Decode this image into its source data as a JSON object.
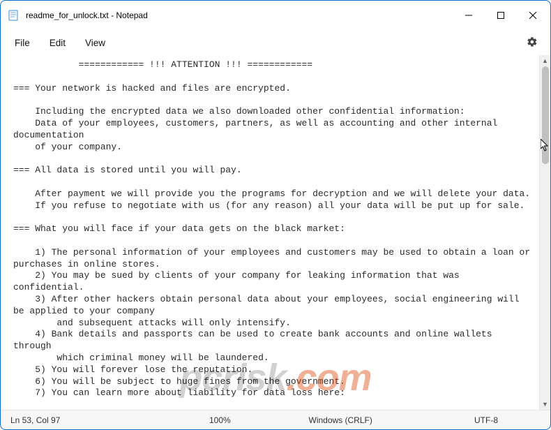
{
  "window": {
    "title": "readme_for_unlock.txt - Notepad"
  },
  "menu": {
    "file": "File",
    "edit": "Edit",
    "view": "View"
  },
  "document": {
    "text": "            ============ !!! ATTENTION !!! ============\n\n=== Your network is hacked and files are encrypted.\n\n    Including the encrypted data we also downloaded other confidential information:\n    Data of your employees, customers, partners, as well as accounting and other internal documentation\n    of your company.\n\n=== All data is stored until you will pay.\n\n    After payment we will provide you the programs for decryption and we will delete your data.\n    If you refuse to negotiate with us (for any reason) all your data will be put up for sale.\n\n=== What you will face if your data gets on the black market:\n\n    1) The personal information of your employees and customers may be used to obtain a loan or purchases in online stores.\n    2) You may be sued by clients of your company for leaking information that was confidential.\n    3) After other hackers obtain personal data about your employees, social engineering will be applied to your company\n        and subsequent attacks will only intensify.\n    4) Bank details and passports can be used to create bank accounts and online wallets through\n        which criminal money will be laundered.\n    5) You will forever lose the reputation.\n    6) You will be subject to huge fines from the government.\n    7) You can learn more about liability for data loss here:"
  },
  "status": {
    "position": "Ln 53, Col 97",
    "zoom": "100%",
    "line_ending": "Windows (CRLF)",
    "encoding": "UTF-8"
  },
  "watermark": {
    "text_a": "pcrisk",
    "text_b": ".com"
  }
}
